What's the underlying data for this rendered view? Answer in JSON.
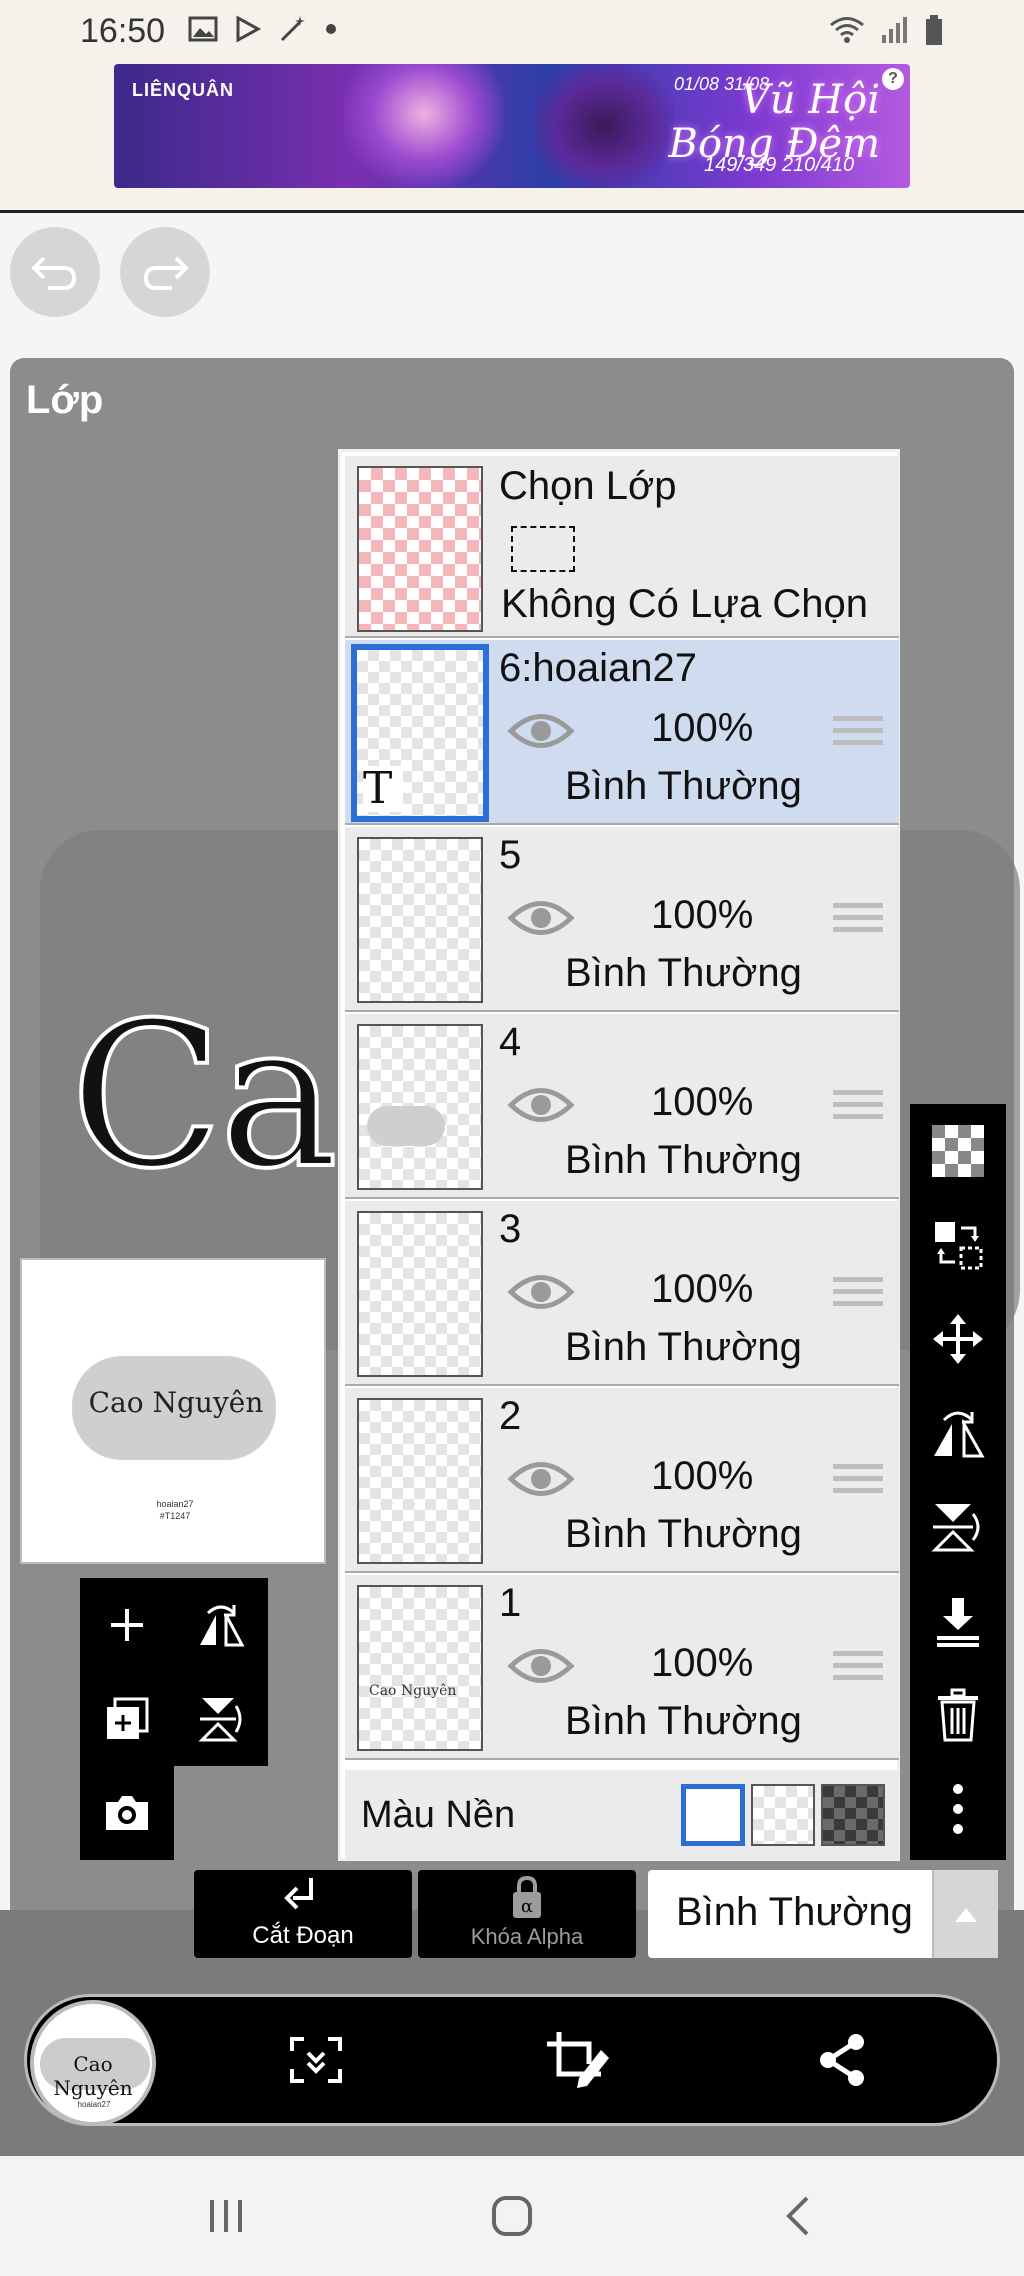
{
  "status_bar": {
    "time": "16:50",
    "left_icons": [
      "image-icon",
      "play-store-icon",
      "magic-wand-icon",
      "dot-icon"
    ],
    "right_icons": [
      "wifi-icon",
      "signal-icon",
      "battery-icon"
    ]
  },
  "ad": {
    "brand": "LIÊNQUÂN",
    "dates": "01/08  31/08",
    "title_line1": "Vũ Hội",
    "title_line2": "Bóng Đêm",
    "scores": "149/349   210/410",
    "info_label": "?"
  },
  "panel": {
    "title": "Lớp",
    "canvas_text": "Cao"
  },
  "thumbnail": {
    "title": "Cao Nguyên",
    "sub_line1": "hoaian27",
    "sub_line2": "#T1247"
  },
  "selection_layer": {
    "title": "Chọn Lớp",
    "subtitle": "Không Có Lựa Chọn"
  },
  "layers": [
    {
      "name": "6:hoaian27",
      "opacity": "100%",
      "blend": "Bình Thường",
      "active": true,
      "thumb_glyph": "T"
    },
    {
      "name": "5",
      "opacity": "100%",
      "blend": "Bình Thường",
      "active": false
    },
    {
      "name": "4",
      "opacity": "100%",
      "blend": "Bình Thường",
      "active": false
    },
    {
      "name": "3",
      "opacity": "100%",
      "blend": "Bình Thường",
      "active": false
    },
    {
      "name": "2",
      "opacity": "100%",
      "blend": "Bình Thường",
      "active": false,
      "thumb_text": "· · · · ·"
    },
    {
      "name": "1",
      "opacity": "100%",
      "blend": "Bình Thường",
      "active": false,
      "thumb_text": "Cao Nguyên"
    }
  ],
  "background": {
    "label": "Màu Nền",
    "options": [
      "white",
      "checker",
      "dark-checker"
    ],
    "selected": "white"
  },
  "right_toolbar": [
    "checker-icon",
    "swap-layers-icon",
    "move-icon",
    "flip-horizontal-icon",
    "flip-vertical-icon",
    "merge-down-icon",
    "trash-icon",
    "more-icon"
  ],
  "left_toolbar": [
    "add-icon",
    "flip-icon",
    "duplicate-icon",
    "flip-vertical-icon",
    "camera-icon"
  ],
  "bottom": {
    "cut_label": "Cắt Đoạn",
    "alpha_label": "Khóa Alpha",
    "blend_mode": "Bình Thường"
  },
  "colors": {
    "accent": "#2b6fd6",
    "active_row": "#cfdbee",
    "panel_gray": "#8c8c8c"
  }
}
